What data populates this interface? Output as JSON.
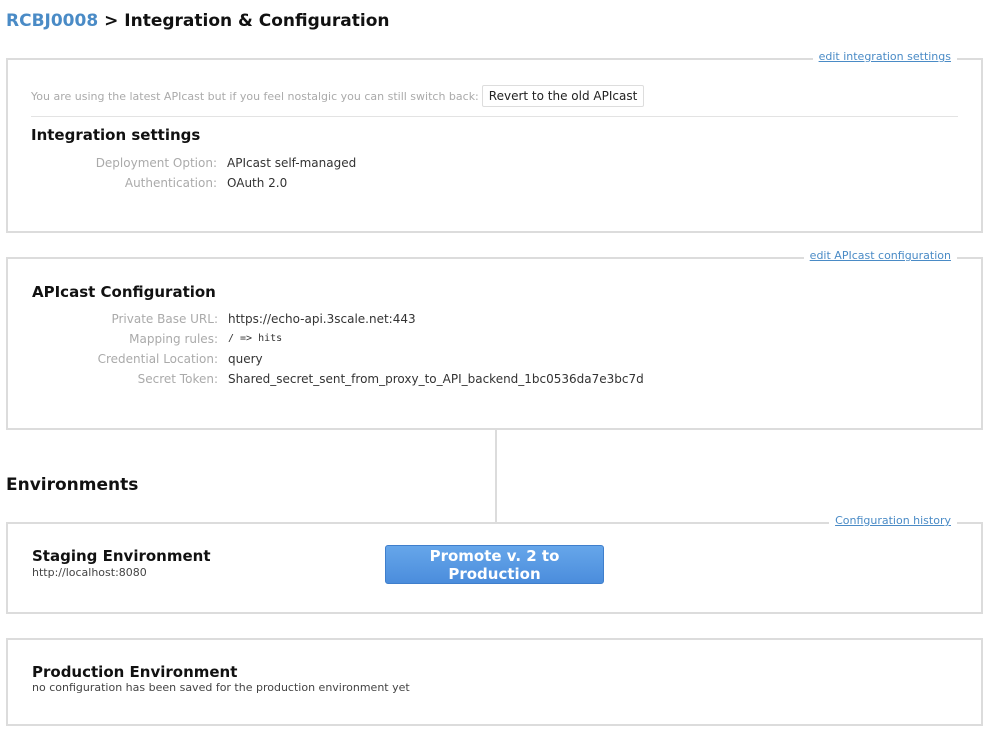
{
  "header": {
    "service_name": "RCBJ0008",
    "separator": ">",
    "page_title": "Integration & Configuration"
  },
  "integration_panel": {
    "edit_link": "edit integration settings",
    "notice_text": "You are using the latest APIcast but if you feel nostalgic you can still switch back:",
    "revert_button": "Revert to the old APIcast",
    "heading": "Integration settings",
    "rows": [
      {
        "label": "Deployment Option:",
        "value": "APIcast self-managed"
      },
      {
        "label": "Authentication:",
        "value": "OAuth 2.0"
      }
    ]
  },
  "apicast_panel": {
    "edit_link": "edit APIcast configuration",
    "heading": "APIcast Configuration",
    "rows": [
      {
        "label": "Private Base URL:",
        "value": "https://echo-api.3scale.net:443"
      },
      {
        "label": "Mapping rules:",
        "value": "/ => hits"
      },
      {
        "label": "Credential Location:",
        "value": "query"
      },
      {
        "label": "Secret Token:",
        "value": "Shared_secret_sent_from_proxy_to_API_backend_1bc0536da7e3bc7d"
      }
    ]
  },
  "environments": {
    "heading": "Environments",
    "history_link": "Configuration history",
    "staging": {
      "title": "Staging Environment",
      "url": "http://localhost:8080",
      "promote_button": "Promote v. 2 to Production"
    },
    "production": {
      "title": "Production Environment",
      "status": "no configuration has been saved for the production environment yet"
    }
  },
  "colors": {
    "link": "#4a8bc6",
    "primary_button": "#5599e2"
  }
}
